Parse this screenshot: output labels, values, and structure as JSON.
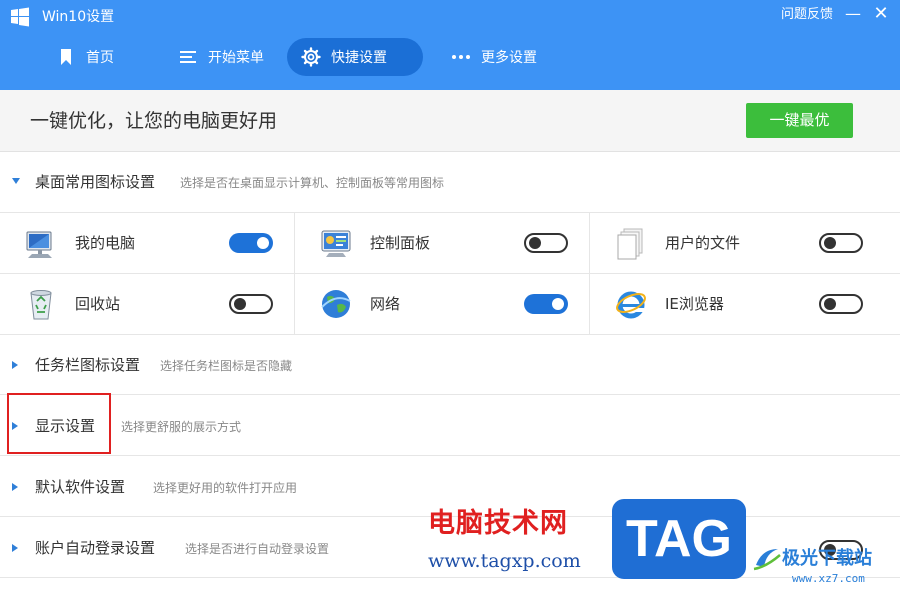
{
  "window": {
    "title": "Win10设置",
    "feedback": "问题反馈",
    "minimize_symbol": "—",
    "close_symbol": "✕"
  },
  "nav": {
    "tabs": [
      {
        "label": "首页",
        "icon": "bookmark-icon",
        "active": false
      },
      {
        "label": "开始菜单",
        "icon": "menu-icon",
        "active": false
      },
      {
        "label": "快捷设置",
        "icon": "gear-icon",
        "active": true
      },
      {
        "label": "更多设置",
        "icon": "more-icon",
        "active": false
      }
    ]
  },
  "optimize": {
    "text": "一键优化，让您的电脑更好用",
    "button": "一键最优"
  },
  "sections": {
    "desktop": {
      "title": "桌面常用图标设置",
      "desc": "选择是否在桌面显示计算机、控制面板等常用图标",
      "expanded": true
    },
    "taskbar": {
      "title": "任务栏图标设置",
      "desc": "选择任务栏图标是否隐藏",
      "expanded": false
    },
    "display": {
      "title": "显示设置",
      "desc": "选择更舒服的展示方式",
      "expanded": false
    },
    "default_apps": {
      "title": "默认软件设置",
      "desc": "选择更好用的软件打开应用",
      "expanded": false
    },
    "account": {
      "title": "账户自动登录设置",
      "desc": "选择是否进行自动登录设置",
      "expanded": false
    }
  },
  "desktop_icons": [
    {
      "label": "我的电脑",
      "icon": "computer-icon",
      "enabled": true
    },
    {
      "label": "控制面板",
      "icon": "control-panel-icon",
      "enabled": false
    },
    {
      "label": "用户的文件",
      "icon": "user-files-icon",
      "enabled": false
    },
    {
      "label": "回收站",
      "icon": "recycle-bin-icon",
      "enabled": false
    },
    {
      "label": "网络",
      "icon": "network-icon",
      "enabled": true
    },
    {
      "label": "IE浏览器",
      "icon": "ie-browser-icon",
      "enabled": false
    }
  ],
  "account_toggle": {
    "enabled": false
  },
  "watermark": {
    "site_name": "电脑技术网",
    "site_url": "www.tagxp.com",
    "tag": "TAG",
    "logo_title": "极光下载站",
    "logo_url": "www.xz7.com"
  },
  "colors": {
    "header": "#3d93f5",
    "active_tab": "#1b6fd6",
    "primary_button": "#3cbe3c",
    "toggle_on": "#1e72d8",
    "highlight": "#e02020"
  }
}
